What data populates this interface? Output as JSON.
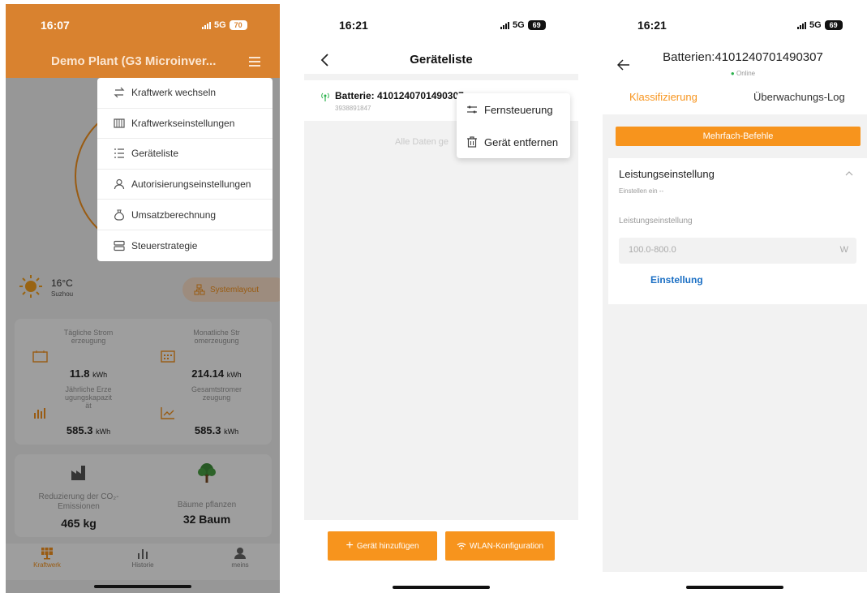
{
  "screen1": {
    "status": {
      "time": "16:07",
      "network": "5G",
      "battery": "70"
    },
    "header_title": "Demo Plant (G3 Microinver...",
    "menu": [
      {
        "label": "Kraftwerk wechseln",
        "icon": "swap-icon"
      },
      {
        "label": "Kraftwerkseinstellungen",
        "icon": "plant-settings-icon"
      },
      {
        "label": "Geräteliste",
        "icon": "list-icon"
      },
      {
        "label": "Autorisierungseinstellungen",
        "icon": "user-icon"
      },
      {
        "label": "Umsatzberechnung",
        "icon": "money-bag-icon"
      },
      {
        "label": "Steuerstrategie",
        "icon": "strategy-icon"
      }
    ],
    "weather": {
      "temp": "16°C",
      "city": "Suzhou"
    },
    "layout_button": "Systemlayout",
    "stats": [
      {
        "label": "Tägliche Stromerzeugung",
        "value": "11.8",
        "unit": "kWh"
      },
      {
        "label": "Monatliche Stromerzeugung",
        "value": "214.14",
        "unit": "kWh"
      },
      {
        "label": "Jährliche Erzeugungskapazität",
        "value": "585.3",
        "unit": "kWh"
      },
      {
        "label": "Gesamtstromerzeugung",
        "value": "585.3",
        "unit": "kWh"
      }
    ],
    "eco": [
      {
        "label": "Reduzierung der CO₂-Emissionen",
        "value": "465 kg"
      },
      {
        "label": "Bäume pflanzen",
        "value": "32 Baum"
      }
    ],
    "tabs": [
      "Kraftwerk",
      "Historie",
      "meins"
    ]
  },
  "screen2": {
    "status": {
      "time": "16:21",
      "network": "5G",
      "battery": "69"
    },
    "title": "Geräteliste",
    "device": {
      "name": "Batterie: 4101240701490307",
      "serial": "3938891847"
    },
    "empty_text": "Alle Daten ge",
    "popover": [
      "Fernsteuerung",
      "Gerät entfernen"
    ],
    "buttons": [
      "Gerät hinzufügen",
      "WLAN-Konfiguration"
    ]
  },
  "screen3": {
    "status": {
      "time": "16:21",
      "network": "5G",
      "battery": "69"
    },
    "title": "Batterien:4101240701490307",
    "online": "Online",
    "tabs": [
      "Klassifizierung",
      "Überwachungs-Log"
    ],
    "multi_button": "Mehrfach-Befehle",
    "section_title": "Leistungseinstellung",
    "section_sub": "Einstellen ein --",
    "field_label": "Leistungseinstellung",
    "input_placeholder": "100.0-800.0",
    "unit": "W",
    "link": "Einstellung"
  },
  "colors": {
    "orange": "#f7941d",
    "header_orange": "#d9822f",
    "link_blue": "#1b6fc4",
    "online_green": "#2bb24c"
  }
}
